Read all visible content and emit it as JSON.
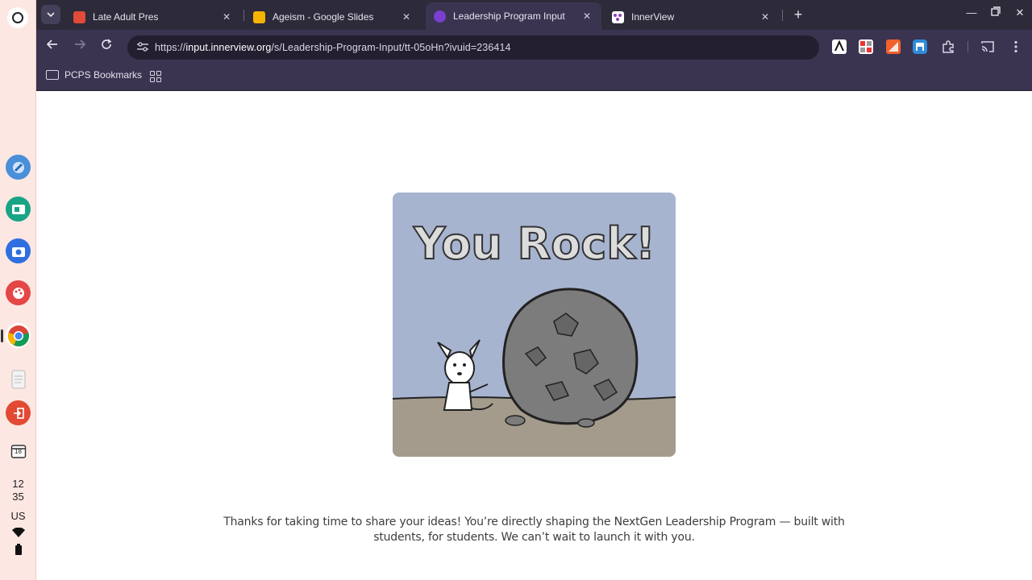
{
  "shelf": {
    "tray_hour": "12",
    "tray_minute": "35",
    "tray_lang": "US",
    "calendar_day": "18"
  },
  "tabs": [
    {
      "title": "Late Adult Pres",
      "favicon_color": "#e04b3a"
    },
    {
      "title": "Ageism - Google Slides",
      "favicon_color": "#f4b400"
    },
    {
      "title": "Leadership Program Input",
      "favicon_color": "#7a3fd0"
    },
    {
      "title": "InnerView",
      "favicon_color": "#8e3fbf"
    }
  ],
  "toolbar": {
    "url_prefix": "https://",
    "url_host": "input.innerview.org",
    "url_path": "/s/Leadership-Program-Input/tt-05oHn?ivuid=236414"
  },
  "bookmarks": {
    "folder_label": "PCPS Bookmarks"
  },
  "page": {
    "image_text": "You Rock!",
    "thanks_line1": "Thanks for taking  time to share your ideas! You’re directly shaping the NextGen Leadership Program — built with",
    "thanks_line2": "students, for students. We can’t wait to launch it with you."
  },
  "colors": {
    "tabstrip_bg": "#2d2a3a",
    "toolbar_bg": "#3a3450",
    "shelf_bg": "#fde7e3",
    "card_sky": "#a7b4d0",
    "card_ground": "#a49b8c"
  }
}
